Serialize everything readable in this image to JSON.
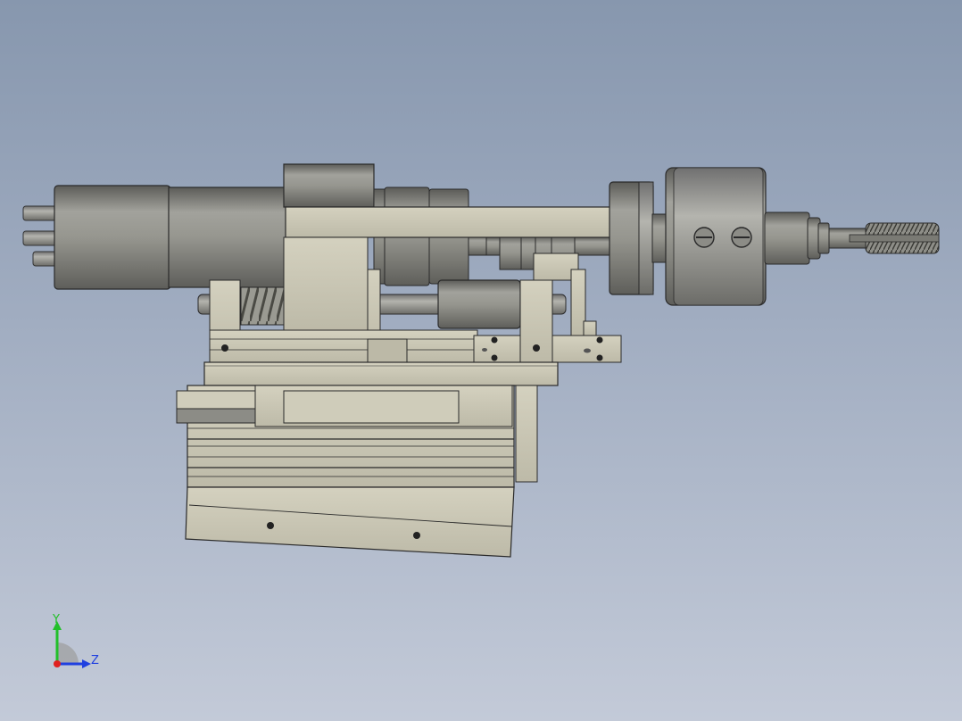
{
  "viewport": {
    "background_top": "#8797ae",
    "background_bottom": "#c3cad8"
  },
  "model": {
    "part_color": "#c9c6b4",
    "edge_color": "#2a2a2a",
    "metal_color": "#8c8c88"
  },
  "triad": {
    "y_label": "Y",
    "z_label": "Z",
    "y_color": "#22c02a",
    "z_color": "#2040e0",
    "x_color": "#e02020"
  }
}
